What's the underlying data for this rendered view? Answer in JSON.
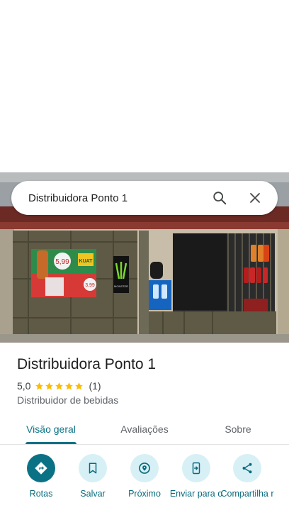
{
  "search": {
    "query": "Distribuidora Ponto 1"
  },
  "place": {
    "name": "Distribuidora Ponto 1",
    "rating": "5,0",
    "stars": 5,
    "review_count": "(1)",
    "category": "Distribuidor de bebidas"
  },
  "photo": {
    "price_tag_1": "5,99",
    "price_tag_2": "3,99",
    "banner_brand": "KUAT",
    "fridge_brand": "MONSTER"
  },
  "tabs": [
    {
      "label": "Visão geral",
      "active": true
    },
    {
      "label": "Avaliações",
      "active": false
    },
    {
      "label": "Sobre",
      "active": false
    }
  ],
  "actions": [
    {
      "label": "Rotas",
      "icon": "directions-icon"
    },
    {
      "label": "Salvar",
      "icon": "bookmark-icon"
    },
    {
      "label": "Próximo",
      "icon": "nearby-icon"
    },
    {
      "label": "Enviar para o",
      "icon": "send-to-phone-icon"
    },
    {
      "label": "Compartilha r",
      "icon": "share-icon"
    }
  ],
  "colors": {
    "accent": "#0b7285",
    "action_bg": "#d7f0f6",
    "star": "#fbbc04"
  }
}
